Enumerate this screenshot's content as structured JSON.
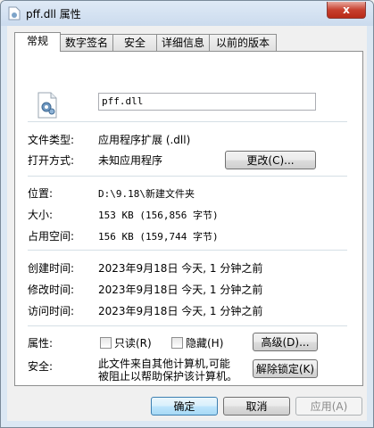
{
  "window": {
    "title": "pff.dll 属性",
    "close": "x"
  },
  "tabs": [
    {
      "label": "常规"
    },
    {
      "label": "数字签名"
    },
    {
      "label": "安全"
    },
    {
      "label": "详细信息"
    },
    {
      "label": "以前的版本"
    }
  ],
  "general": {
    "filename": "pff.dll",
    "file_type": {
      "label": "文件类型:",
      "value": "应用程序扩展 (.dll)"
    },
    "opens_with": {
      "label": "打开方式:",
      "value": "未知应用程序",
      "change_button": "更改(C)..."
    },
    "location": {
      "label": "位置:",
      "value": "D:\\9.18\\新建文件夹"
    },
    "size": {
      "label": "大小:",
      "value": "153 KB (156,856 字节)"
    },
    "size_on_disk": {
      "label": "占用空间:",
      "value": "156 KB (159,744 字节)"
    },
    "created": {
      "label": "创建时间:",
      "value": "2023年9月18日 今天, 1 分钟之前"
    },
    "modified": {
      "label": "修改时间:",
      "value": "2023年9月18日 今天, 1 分钟之前"
    },
    "accessed": {
      "label": "访问时间:",
      "value": "2023年9月18日 今天, 1 分钟之前"
    },
    "attributes": {
      "label": "属性:",
      "readonly": "只读(R)",
      "hidden": "隐藏(H)",
      "advanced_button": "高级(D)..."
    },
    "security": {
      "label": "安全:",
      "line1": "此文件来自其他计算机,可能",
      "line2": "被阻止以帮助保护该计算机。",
      "unblock_button": "解除锁定(K)"
    }
  },
  "buttons": {
    "ok": "确定",
    "cancel": "取消",
    "apply": "应用(A)"
  }
}
